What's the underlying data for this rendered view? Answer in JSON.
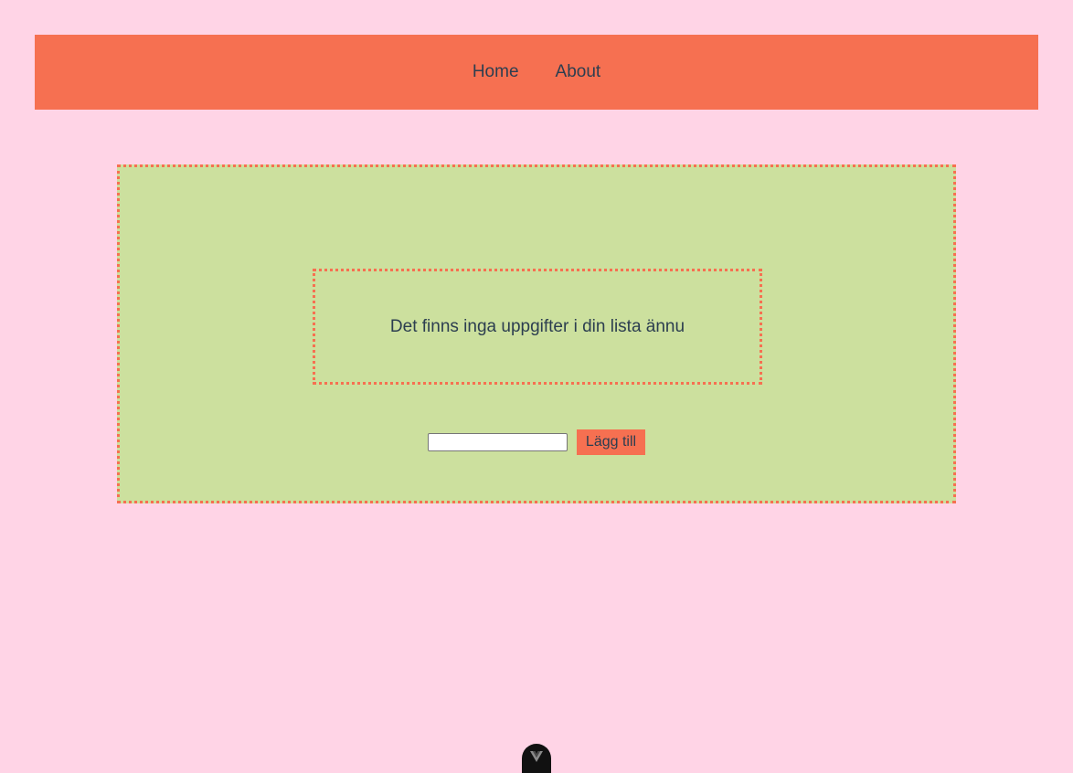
{
  "nav": {
    "links": [
      {
        "label": "Home"
      },
      {
        "label": "About"
      }
    ]
  },
  "todo": {
    "empty_message": "Det finns inga uppgifter i din lista ännu",
    "input_value": "",
    "add_button_label": "Lägg till"
  },
  "colors": {
    "page_background": "#ffd4e6",
    "accent": "#f67051",
    "panel_background": "#cce09e",
    "text": "#2c3e50"
  },
  "icons": {
    "devtools": "vue-devtools-icon"
  }
}
